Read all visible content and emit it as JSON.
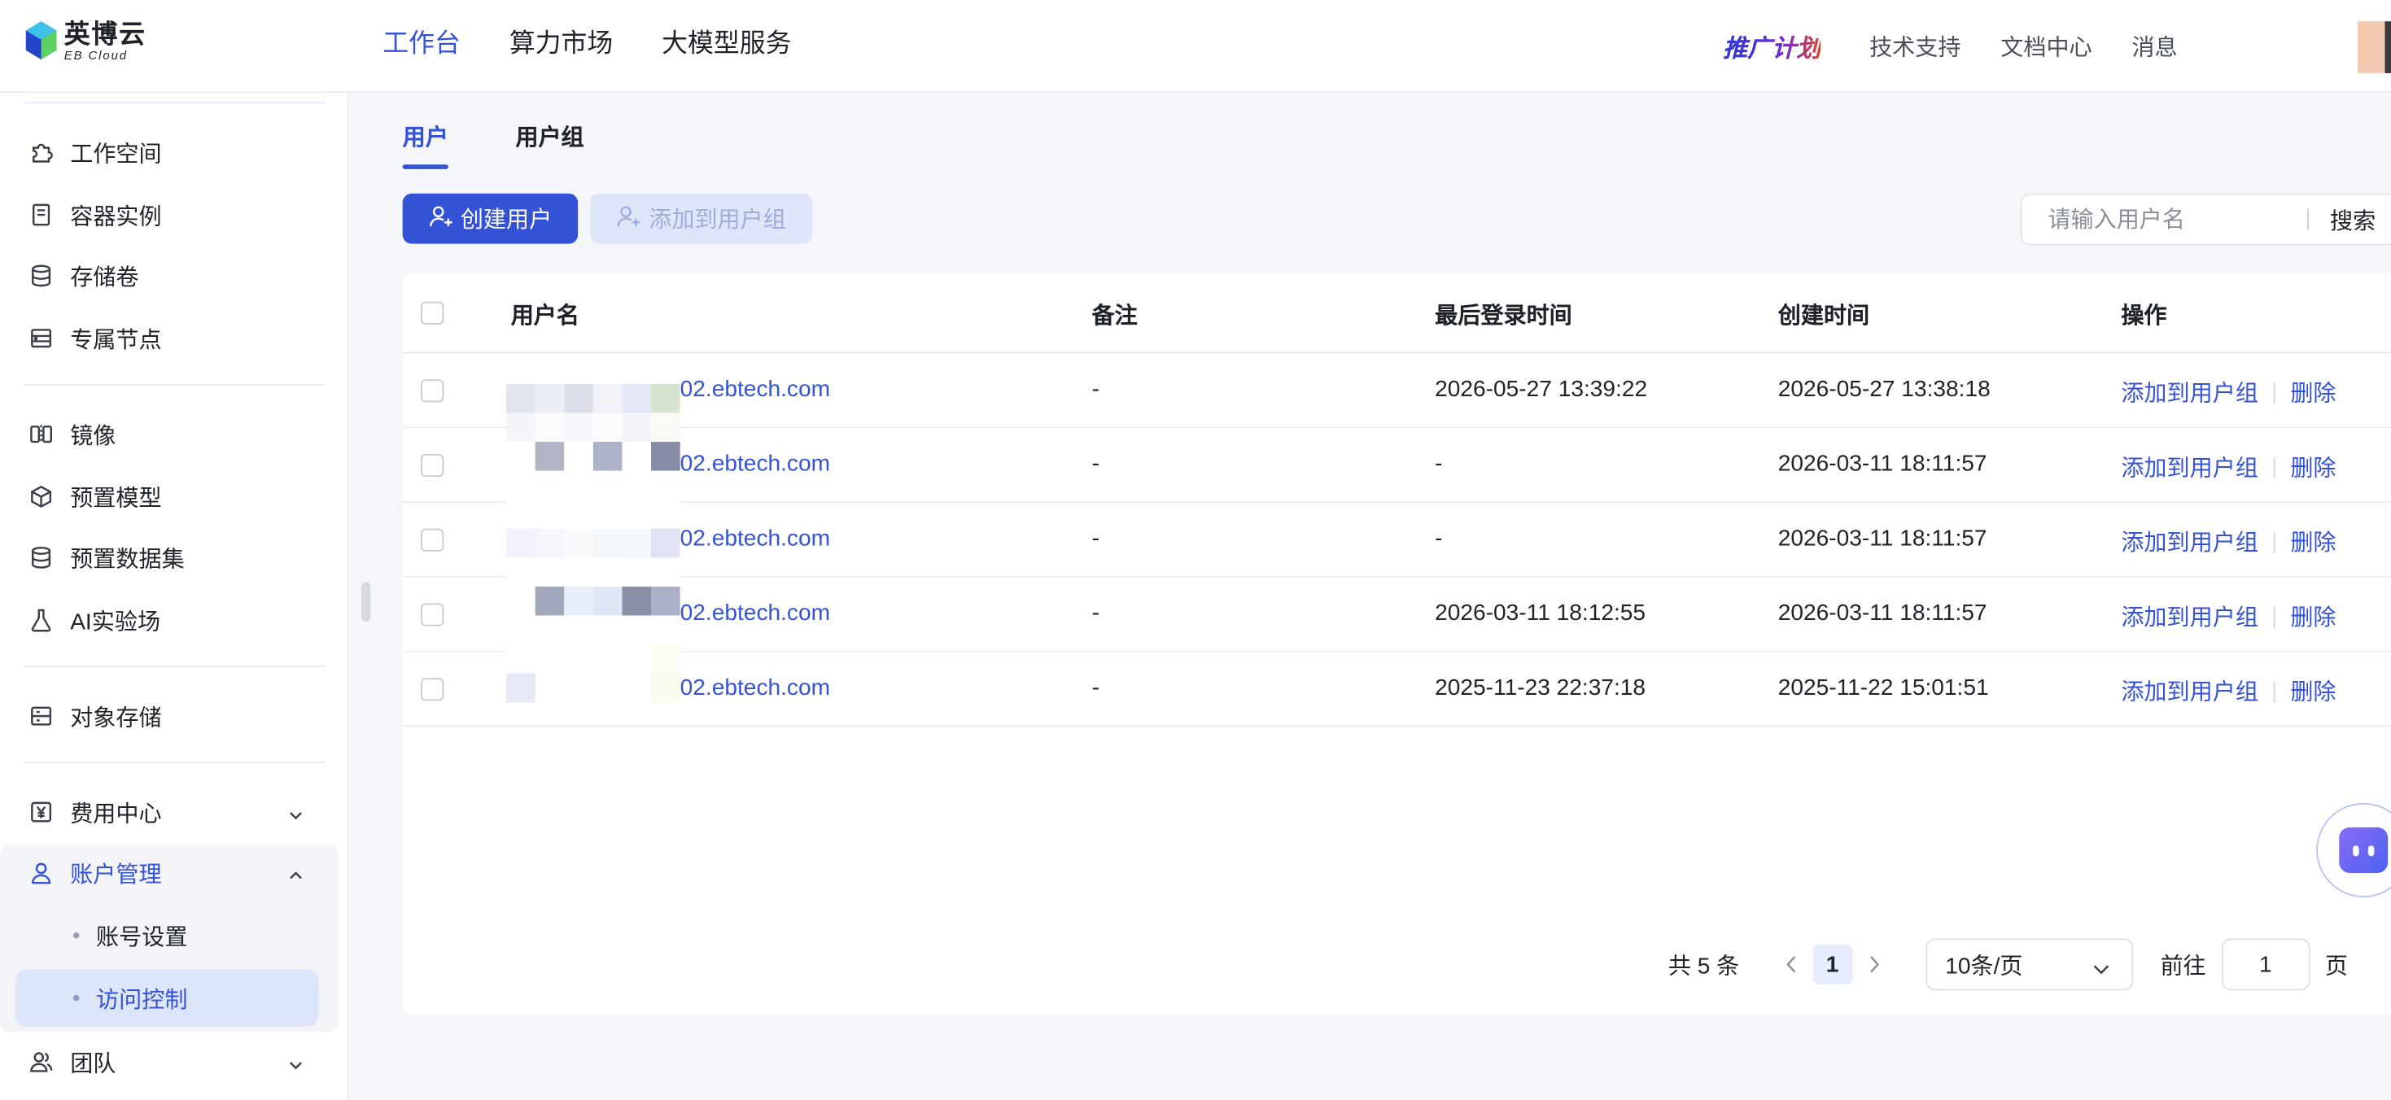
{
  "app": {
    "logo_cn": "英博云",
    "logo_en": "EB Cloud"
  },
  "topnav": {
    "items": [
      "工作台",
      "算力市场",
      "大模型服务"
    ],
    "active": "工作台"
  },
  "toplinks": {
    "promo": "推广计划",
    "support": "技术支持",
    "docs": "文档中心",
    "messages": "消息"
  },
  "sidebar": {
    "items": [
      {
        "label": "工作空间",
        "icon": "puzzle-icon"
      },
      {
        "label": "容器实例",
        "icon": "container-icon"
      },
      {
        "label": "存储卷",
        "icon": "database-icon"
      },
      {
        "label": "专属节点",
        "icon": "node-icon"
      },
      {
        "label": "镜像",
        "icon": "mirror-icon"
      },
      {
        "label": "预置模型",
        "icon": "cube-icon"
      },
      {
        "label": "预置数据集",
        "icon": "dataset-icon"
      },
      {
        "label": "AI实验场",
        "icon": "flask-icon"
      },
      {
        "label": "对象存储",
        "icon": "storage-icon"
      },
      {
        "label": "费用中心",
        "icon": "yen-icon"
      },
      {
        "label": "账户管理",
        "icon": "user-icon"
      },
      {
        "label": "团队",
        "icon": "team-icon"
      }
    ],
    "sub_items": [
      "账号设置",
      "访问控制"
    ]
  },
  "tabs": [
    "用户",
    "用户组"
  ],
  "toolbar": {
    "create_user": "创建用户",
    "add_to_group": "添加到用户组"
  },
  "search": {
    "placeholder": "请输入用户名",
    "button": "搜索"
  },
  "table": {
    "columns": [
      "用户名",
      "备注",
      "最后登录时间",
      "创建时间",
      "操作"
    ],
    "rows": [
      {
        "username": "02.ebtech.com",
        "note": "-",
        "last_login": "2026-05-27 13:39:22",
        "created": "2026-05-27 13:38:18"
      },
      {
        "username": "02.ebtech.com",
        "note": "-",
        "last_login": "-",
        "created": "2026-03-11 18:11:57"
      },
      {
        "username": "02.ebtech.com",
        "note": "-",
        "last_login": "-",
        "created": "2026-03-11 18:11:57"
      },
      {
        "username": "02.ebtech.com",
        "note": "-",
        "last_login": "2026-03-11 18:12:55",
        "created": "2026-03-11 18:11:57"
      },
      {
        "username": "02.ebtech.com",
        "note": "-",
        "last_login": "2025-11-23 22:37:18",
        "created": "2025-11-22 15:01:51"
      }
    ],
    "action_add": "添加到用户组",
    "action_delete": "删除"
  },
  "pagination": {
    "total": "共 5 条",
    "current_page": "1",
    "page_size": "10条/页",
    "goto_label": "前往",
    "goto_value": "1",
    "page_suffix": "页"
  },
  "colors": {
    "accent": "#3452d6",
    "accent_light": "#dde5fb"
  }
}
